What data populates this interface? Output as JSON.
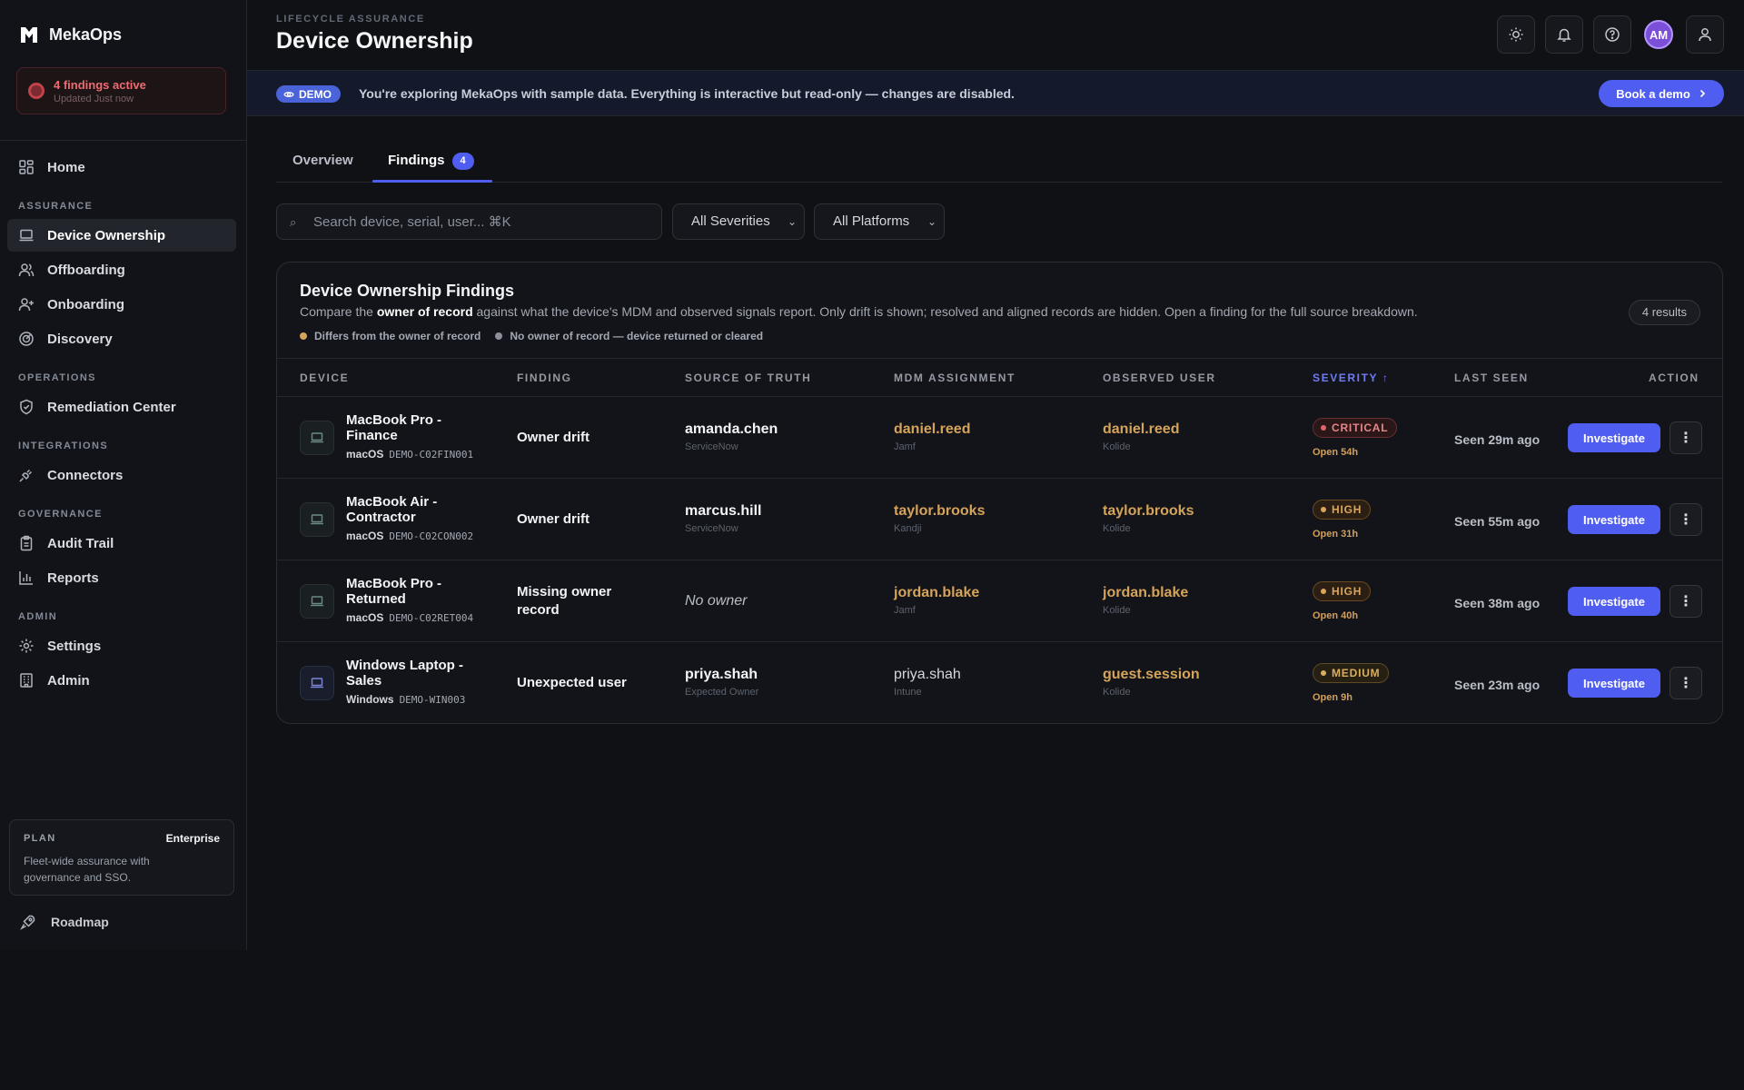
{
  "brand": {
    "name": "MekaOps"
  },
  "alert": {
    "title": "4 findings active",
    "subtitle": "Updated Just now"
  },
  "nav": {
    "home": "Home",
    "sections": {
      "assurance": "ASSURANCE",
      "operations": "OPERATIONS",
      "integrations": "INTEGRATIONS",
      "governance": "GOVERNANCE",
      "admin": "ADMIN"
    },
    "device_ownership": "Device Ownership",
    "offboarding": "Offboarding",
    "onboarding": "Onboarding",
    "discovery": "Discovery",
    "remediation": "Remediation Center",
    "connectors": "Connectors",
    "audit": "Audit Trail",
    "reports": "Reports",
    "settings": "Settings",
    "admin": "Admin"
  },
  "plan": {
    "label": "PLAN",
    "tier": "Enterprise",
    "description": "Fleet-wide assurance with governance and SSO."
  },
  "roadmap": "Roadmap",
  "header": {
    "eyebrow": "LIFECYCLE ASSURANCE",
    "title": "Device Ownership",
    "avatar_initials": "AM"
  },
  "banner": {
    "pill": "DEMO",
    "text": "You're exploring MekaOps with sample data. Everything is interactive but read-only — changes are disabled.",
    "cta": "Book a demo"
  },
  "tabs": {
    "overview": "Overview",
    "findings": "Findings",
    "findings_count": "4"
  },
  "filters": {
    "search_placeholder": "Search device, serial, user... ⌘K",
    "severity": "All Severities",
    "platform": "All Platforms"
  },
  "panel": {
    "title": "Device Ownership Findings",
    "desc_prefix": "Compare the ",
    "desc_bold": "owner of record",
    "desc_suffix": " against what the device's MDM and observed signals report. Only drift is shown; resolved and aligned records are hidden. Open a finding for the full source breakdown.",
    "results": "4 results",
    "legend": [
      {
        "label": "Differs from the owner of record",
        "color": "#d5a35a"
      },
      {
        "label": "No owner of record — device returned or cleared",
        "color": "#8b909b"
      }
    ]
  },
  "columns": {
    "device": "DEVICE",
    "finding": "FINDING",
    "source": "SOURCE OF TRUTH",
    "mdm": "MDM ASSIGNMENT",
    "observed": "OBSERVED USER",
    "severity": "SEVERITY ↑",
    "last_seen": "LAST SEEN",
    "action": "ACTION"
  },
  "rows": [
    {
      "name": "MacBook Pro - Finance",
      "os": "macOS",
      "serial": "DEMO-C02FIN001",
      "finding": "Owner drift",
      "source_user": "amanda.chen",
      "source_sys": "ServiceNow",
      "mdm_user": "daniel.reed",
      "mdm_sys": "Jamf",
      "obs_user": "daniel.reed",
      "obs_sys": "Kolide",
      "severity": "CRITICAL",
      "open": "Open 54h",
      "seen": "Seen 29m ago",
      "action": "Investigate"
    },
    {
      "name": "MacBook Air - Contractor",
      "os": "macOS",
      "serial": "DEMO-C02CON002",
      "finding": "Owner drift",
      "source_user": "marcus.hill",
      "source_sys": "ServiceNow",
      "mdm_user": "taylor.brooks",
      "mdm_sys": "Kandji",
      "obs_user": "taylor.brooks",
      "obs_sys": "Kolide",
      "severity": "HIGH",
      "open": "Open 31h",
      "seen": "Seen 55m ago",
      "action": "Investigate"
    },
    {
      "name": "MacBook Pro - Returned",
      "os": "macOS",
      "serial": "DEMO-C02RET004",
      "finding": "Missing owner record",
      "source_user": "No owner",
      "source_sys": "",
      "mdm_user": "jordan.blake",
      "mdm_sys": "Jamf",
      "obs_user": "jordan.blake",
      "obs_sys": "Kolide",
      "severity": "HIGH",
      "open": "Open 40h",
      "seen": "Seen 38m ago",
      "action": "Investigate"
    },
    {
      "name": "Windows Laptop - Sales",
      "os": "Windows",
      "serial": "DEMO-WIN003",
      "finding": "Unexpected user",
      "source_user": "priya.shah",
      "source_sys": "Expected Owner",
      "mdm_user": "priya.shah",
      "mdm_sys": "Intune",
      "obs_user": "guest.session",
      "obs_sys": "Kolide",
      "severity": "MEDIUM",
      "open": "Open 9h",
      "seen": "Seen 23m ago",
      "action": "Investigate"
    }
  ]
}
